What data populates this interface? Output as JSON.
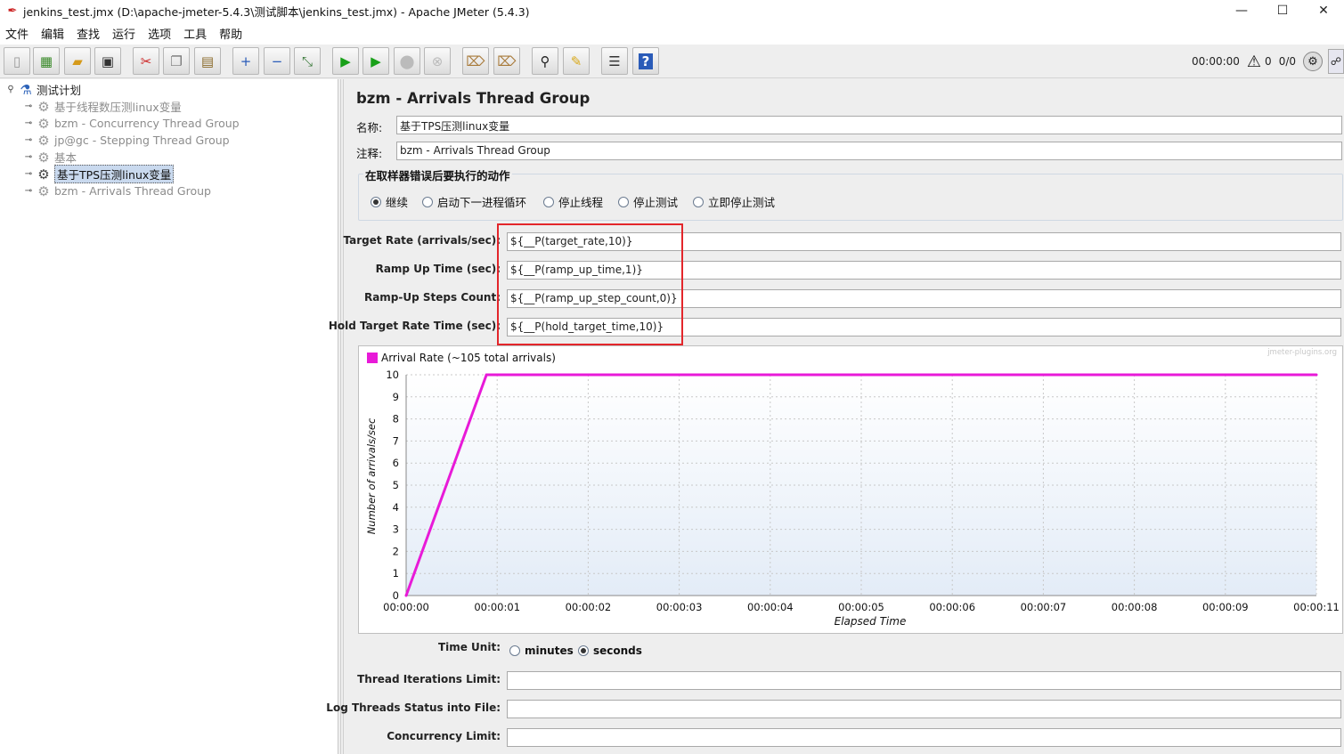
{
  "window": {
    "title": "jenkins_test.jmx (D:\\apache-jmeter-5.4.3\\测试脚本\\jenkins_test.jmx) - Apache JMeter (5.4.3)",
    "minimize": "—",
    "maximize": "☐",
    "close": "✕"
  },
  "menu": [
    "文件",
    "编辑",
    "查找",
    "运行",
    "选项",
    "工具",
    "帮助"
  ],
  "toolbar": {
    "icons": [
      "new-icon",
      "templates-icon",
      "open-icon",
      "save-icon",
      "cut-icon",
      "copy-icon",
      "paste-icon",
      "expand-icon",
      "collapse-icon",
      "toggle-icon",
      "start-icon",
      "start-no-pauses-icon",
      "stop-icon",
      "shutdown-icon",
      "clear-icon",
      "clear-all-icon",
      "search-icon",
      "reset-search-icon",
      "function-helper-icon",
      "help-icon"
    ],
    "timer": "00:00:00",
    "error_count": "0",
    "threads": "0/0"
  },
  "tree": {
    "root": "测试计划",
    "items": [
      {
        "label": "基于线程数压测linux变量",
        "disabled": true
      },
      {
        "label": "bzm - Concurrency Thread Group",
        "disabled": true
      },
      {
        "label": "jp@gc - Stepping Thread Group",
        "disabled": true
      },
      {
        "label": "基本",
        "disabled": true
      },
      {
        "label": "基于TPS压测linux变量",
        "disabled": false,
        "selected": true
      },
      {
        "label": "bzm - Arrivals Thread Group",
        "disabled": true
      }
    ]
  },
  "panel": {
    "title": "bzm - Arrivals Thread Group",
    "name_label": "名称:",
    "name_value": "基于TPS压测linux变量",
    "comment_label": "注释:",
    "comment_value": "bzm - Arrivals Thread Group",
    "action_group_title": "在取样器错误后要执行的动作",
    "actions": [
      {
        "label": "继续",
        "checked": true
      },
      {
        "label": "启动下一进程循环",
        "checked": false
      },
      {
        "label": "停止线程",
        "checked": false
      },
      {
        "label": "停止测试",
        "checked": false
      },
      {
        "label": "立即停止测试",
        "checked": false
      }
    ],
    "params": [
      {
        "label": "Target Rate (arrivals/sec):",
        "value": "${__P(target_rate,10)}"
      },
      {
        "label": "Ramp Up Time (sec):",
        "value": "${__P(ramp_up_time,1)}"
      },
      {
        "label": "Ramp-Up Steps Count:",
        "value": "${__P(ramp_up_step_count,0)}"
      },
      {
        "label": "Hold Target Rate Time (sec):",
        "value": "${__P(hold_target_time,10)}"
      }
    ],
    "time_unit_label": "Time Unit:",
    "time_units": [
      {
        "label": "minutes",
        "checked": false
      },
      {
        "label": "seconds",
        "checked": true
      }
    ],
    "thread_iterations_label": "Thread Iterations Limit:",
    "thread_iterations_value": "",
    "log_threads_label": "Log Threads Status into File:",
    "log_threads_value": "",
    "concurrency_label": "Concurrency Limit:",
    "concurrency_value": ""
  },
  "chart_data": {
    "type": "line",
    "title": "",
    "legend": "Arrival Rate (~105 total arrivals)",
    "watermark": "jmeter-plugins.org",
    "xlabel": "Elapsed Time",
    "ylabel": "Number of arrivals/sec",
    "x_ticks": [
      "00:00:00",
      "00:00:01",
      "00:00:02",
      "00:00:03",
      "00:00:04",
      "00:00:05",
      "00:00:06",
      "00:00:07",
      "00:00:08",
      "00:00:09",
      "00:00:11"
    ],
    "y_ticks": [
      0,
      1,
      2,
      3,
      4,
      5,
      6,
      7,
      8,
      9,
      10
    ],
    "xlim": [
      0,
      10.2
    ],
    "ylim": [
      0,
      10
    ],
    "grid": true,
    "series": [
      {
        "name": "Arrival Rate (~105 total arrivals)",
        "color": "#e81ad8",
        "x": [
          0,
          0.9,
          10.2
        ],
        "y": [
          0,
          10,
          10
        ]
      }
    ]
  }
}
